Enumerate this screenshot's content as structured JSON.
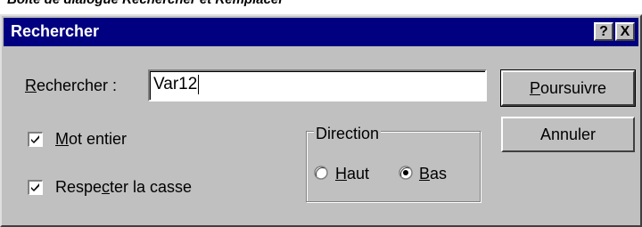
{
  "caption": "Boîte de dialogue Rechercher et Remplacer",
  "dialog": {
    "title": "Rechercher",
    "help_glyph": "?",
    "close_glyph": "X"
  },
  "find": {
    "label_accel": "R",
    "label_rest": "echercher :",
    "value": "Var12"
  },
  "buttons": {
    "find_next_accel": "P",
    "find_next_rest": "oursuivre",
    "cancel": "Annuler"
  },
  "options": {
    "whole_word_accel": "M",
    "whole_word_rest": "ot entier",
    "whole_word_checked": true,
    "match_case_pre": "Respe",
    "match_case_accel": "c",
    "match_case_post": "ter la casse",
    "match_case_checked": true
  },
  "direction": {
    "legend": "Direction",
    "up_accel": "H",
    "up_rest": "aut",
    "down_accel": "B",
    "down_rest": "as",
    "selected": "down"
  }
}
